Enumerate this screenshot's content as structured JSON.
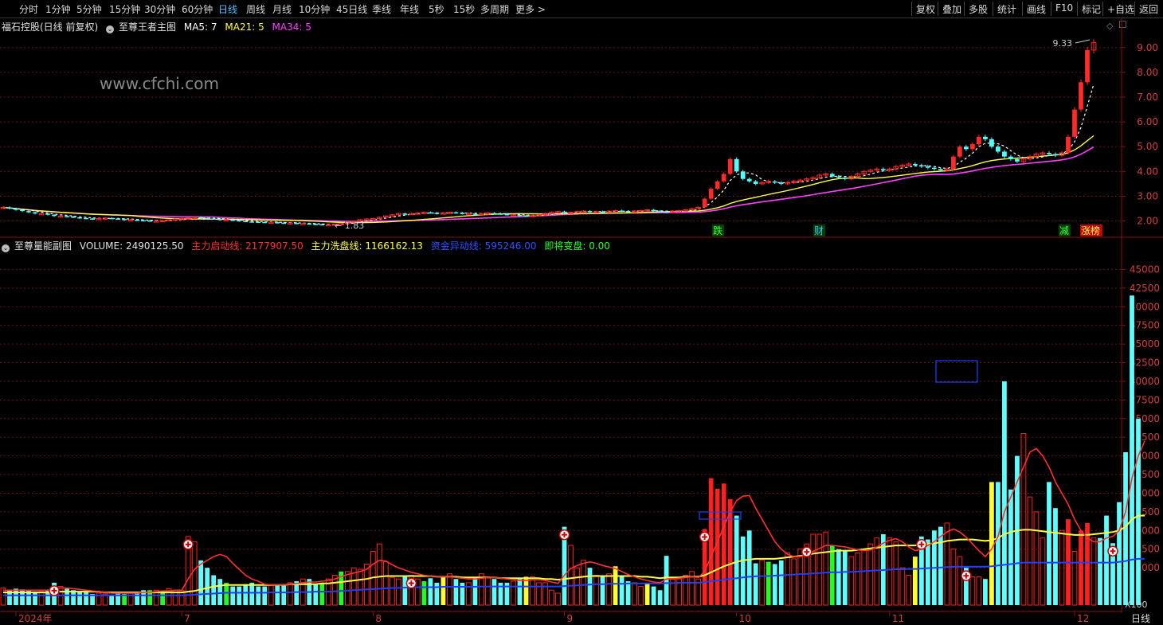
{
  "toolbar": {
    "periods": [
      "分时",
      "1分钟",
      "5分钟",
      "15分钟",
      "30分钟",
      "60分钟",
      "日线",
      "周线",
      "月线",
      "10分钟",
      "45日线",
      "季线",
      "年线",
      "5秒",
      "15秒",
      "多周期",
      "更多 >"
    ],
    "active_index": 6,
    "right": [
      "复权",
      "叠加",
      "多股",
      "统计",
      "画线",
      "F10",
      "标记",
      "+自选",
      "返回"
    ]
  },
  "main_panel": {
    "title": "福石控股(日线 前复权)",
    "indicator": "至尊王者主图",
    "ma5": "MA5: 7",
    "ma21": "MA21: 5",
    "ma34": "MA34: 5",
    "watermark": "www.cfchi.com",
    "high_label": "9.33",
    "low_label": "1.83",
    "markers": [
      "跌",
      "财",
      "减",
      "涨榜"
    ]
  },
  "sub_panel": {
    "title": "至尊量能副图",
    "volume": "VOLUME: 2490125.50",
    "line1": "主力启动线: 2177907.50",
    "line2": "主力洗盘线: 1166162.13",
    "line3": "资金异动线: 595246.00",
    "line4": "即将变盘: 0.00",
    "multiplier": "X100"
  },
  "bottom_label": "日线",
  "colors": {
    "up": "#ff2a2a",
    "down": "#54ffff",
    "ma5": "#ffffff",
    "ma21": "#ffff40",
    "ma34": "#ff40ff",
    "grid": "#6a1414",
    "vol_red": "#ff2020",
    "vol_cyan": "#60ffff",
    "vol_green": "#20ff20",
    "vol_yellow": "#ffff30",
    "line_red": "#ff3030",
    "line_yellow": "#ffff40",
    "line_blue": "#2040ff"
  },
  "chart_data": [
    {
      "type": "candlestick",
      "title": "福石控股(日线 前复权)",
      "ylim": [
        1.6,
        9.7
      ],
      "y_ticks": [
        2.0,
        3.0,
        4.0,
        5.0,
        6.0,
        7.0,
        8.0,
        9.0
      ],
      "x_ticks": [
        {
          "label": "2024年",
          "index": 2
        },
        {
          "label": "7",
          "index": 28
        },
        {
          "label": "8",
          "index": 58
        },
        {
          "label": "9",
          "index": 88
        },
        {
          "label": "10",
          "index": 115
        },
        {
          "label": "11",
          "index": 139
        },
        {
          "label": "12",
          "index": 168
        }
      ],
      "close": [
        2.55,
        2.5,
        2.45,
        2.4,
        2.35,
        2.3,
        2.3,
        2.25,
        2.2,
        2.2,
        2.18,
        2.15,
        2.12,
        2.1,
        2.08,
        2.1,
        2.12,
        2.1,
        2.08,
        2.05,
        2.05,
        2.03,
        2.02,
        2.0,
        2.0,
        2.02,
        2.05,
        2.08,
        2.1,
        2.12,
        2.15,
        2.12,
        2.1,
        2.08,
        2.05,
        2.05,
        2.03,
        2.0,
        1.98,
        1.97,
        1.96,
        1.95,
        1.95,
        1.93,
        1.92,
        1.92,
        1.9,
        1.9,
        1.88,
        1.87,
        1.85,
        1.85,
        1.87,
        1.9,
        1.95,
        2.0,
        2.05,
        2.08,
        2.1,
        2.15,
        2.2,
        2.25,
        2.3,
        2.28,
        2.3,
        2.32,
        2.35,
        2.33,
        2.3,
        2.32,
        2.35,
        2.33,
        2.3,
        2.3,
        2.28,
        2.3,
        2.32,
        2.3,
        2.28,
        2.25,
        2.25,
        2.22,
        2.2,
        2.22,
        2.25,
        2.3,
        2.35,
        2.38,
        2.35,
        2.35,
        2.38,
        2.4,
        2.38,
        2.38,
        2.35,
        2.4,
        2.42,
        2.4,
        2.38,
        2.4,
        2.42,
        2.45,
        2.4,
        2.38,
        2.35,
        2.4,
        2.42,
        2.45,
        2.5,
        2.55,
        2.9,
        3.3,
        3.6,
        3.9,
        4.5,
        4.0,
        3.7,
        3.6,
        3.5,
        3.55,
        3.6,
        3.55,
        3.5,
        3.55,
        3.6,
        3.65,
        3.7,
        3.75,
        3.85,
        3.9,
        3.8,
        3.75,
        3.7,
        3.8,
        3.9,
        4.0,
        4.05,
        4.1,
        4.05,
        4.1,
        4.2,
        4.25,
        4.3,
        4.25,
        4.2,
        4.15,
        4.1,
        4.05,
        4.1,
        4.6,
        5.0,
        4.9,
        5.1,
        5.4,
        5.3,
        5.0,
        4.8,
        4.6,
        4.5,
        4.4,
        4.5,
        4.6,
        4.7,
        4.75,
        4.7,
        4.65,
        4.75,
        5.4,
        6.5,
        7.6,
        8.9,
        9.2
      ],
      "volume": [
        2300,
        2000,
        2200,
        2100,
        1900,
        1800,
        1800,
        1900,
        3000,
        2500,
        2200,
        2000,
        1800,
        1700,
        1500,
        1600,
        1500,
        1400,
        1600,
        1500,
        1700,
        1600,
        2000,
        2000,
        2000,
        1900,
        2200,
        2000,
        2000,
        9200,
        8500,
        6000,
        5000,
        4000,
        3500,
        3000,
        2500,
        2500,
        2800,
        3000,
        2500,
        2500,
        2600,
        2700,
        2800,
        3000,
        3200,
        3500,
        3500,
        2800,
        3000,
        3500,
        4000,
        4500,
        4500,
        5000,
        4800,
        5500,
        7200,
        8200,
        5800,
        3700,
        3500,
        3800,
        4000,
        3500,
        3200,
        3600,
        3000,
        3800,
        4200,
        3500,
        3000,
        3000,
        3800,
        4200,
        3800,
        3500,
        3000,
        3000,
        3200,
        3500,
        3800,
        3800,
        3000,
        3000,
        2000,
        1600,
        10500,
        8000,
        5000,
        6000,
        5000,
        4000,
        3800,
        4200,
        5200,
        3800,
        3200,
        3000,
        2500,
        3000,
        2500,
        2000,
        6600,
        3500,
        3500,
        4000,
        4500,
        3500,
        10200,
        17000,
        15600,
        16300,
        14200,
        12000,
        9200,
        10000,
        5600,
        6000,
        5800,
        5500,
        6000,
        7000,
        6200,
        7500,
        8200,
        9500,
        9500,
        9800,
        8000,
        7500,
        7200,
        6500,
        7000,
        7500,
        8200,
        9000,
        9500,
        9000,
        8500,
        5000,
        4000,
        6500,
        9200,
        8800,
        10000,
        10500,
        11000,
        7500,
        6500,
        5000,
        3800,
        3800,
        3500,
        16500,
        16500,
        30000,
        15500,
        20000,
        23000,
        14500,
        12500,
        9000,
        16500,
        13000,
        10000,
        11500,
        7200,
        10000,
        11000,
        9000,
        9000,
        12000,
        8300,
        13800,
        20500,
        41500,
        25000
      ],
      "ma_vol_red": [
        2000,
        2000,
        2000,
        2000,
        2000,
        2000,
        2000,
        2000,
        2200,
        2300,
        2300,
        2200,
        2100,
        2000,
        1900,
        1800,
        1700,
        1600,
        1600,
        1600,
        1600,
        1600,
        1700,
        1700,
        1800,
        1900,
        1900,
        2000,
        2000,
        3500,
        4800,
        5500,
        6000,
        6500,
        6800,
        6500,
        5600,
        4800,
        4000,
        3500,
        3200,
        2800,
        2700,
        2700,
        2700,
        2800,
        2900,
        3000,
        3100,
        3100,
        3200,
        3300,
        3500,
        3800,
        4100,
        4300,
        4500,
        4800,
        5500,
        6000,
        5900,
        5400,
        5000,
        4700,
        4400,
        4200,
        4000,
        3900,
        3800,
        3800,
        3800,
        3700,
        3600,
        3500,
        3500,
        3600,
        3700,
        3700,
        3600,
        3500,
        3400,
        3300,
        3300,
        3400,
        3400,
        3300,
        3100,
        2900,
        4000,
        4900,
        5300,
        5600,
        5800,
        5600,
        5300,
        5100,
        4900,
        4500,
        4100,
        3800,
        3500,
        3300,
        3100,
        3000,
        3500,
        3500,
        3600,
        3700,
        3800,
        3700,
        4500,
        6500,
        8500,
        10500,
        12500,
        14000,
        14600,
        14700,
        13000,
        11500,
        10000,
        8500,
        7500,
        6800,
        6500,
        6500,
        6700,
        7200,
        7600,
        8000,
        8000,
        7900,
        7800,
        7600,
        7400,
        7300,
        7400,
        7800,
        8300,
        8700,
        8900,
        8500,
        7800,
        7300,
        7500,
        8000,
        8500,
        9200,
        9800,
        10200,
        9800,
        9100,
        8200,
        7300,
        6500,
        7500,
        9200,
        12500,
        14500,
        16500,
        18500,
        20500,
        21000,
        20000,
        18500,
        16500,
        15000,
        13500,
        11500,
        10000,
        9000,
        8500,
        8500,
        9000,
        9200,
        10000,
        12500,
        17000,
        20000,
        22000
      ],
      "ma_vol_yellow": [
        1700,
        1700,
        1700,
        1700,
        1700,
        1700,
        1700,
        1700,
        1800,
        1800,
        1800,
        1800,
        1800,
        1800,
        1800,
        1800,
        1700,
        1700,
        1700,
        1700,
        1700,
        1700,
        1700,
        1700,
        1700,
        1700,
        1700,
        1700,
        1700,
        1800,
        1900,
        2100,
        2300,
        2500,
        2600,
        2700,
        2700,
        2700,
        2700,
        2700,
        2700,
        2700,
        2700,
        2700,
        2700,
        2800,
        2800,
        2800,
        2800,
        2800,
        2900,
        2900,
        3000,
        3100,
        3200,
        3300,
        3400,
        3500,
        3700,
        3800,
        3900,
        3900,
        3900,
        3900,
        3900,
        3900,
        3900,
        3900,
        3800,
        3800,
        3800,
        3800,
        3700,
        3700,
        3700,
        3700,
        3700,
        3700,
        3600,
        3600,
        3600,
        3600,
        3600,
        3600,
        3600,
        3500,
        3500,
        3400,
        3500,
        3600,
        3700,
        3800,
        3900,
        3900,
        3900,
        3900,
        3900,
        3900,
        3900,
        3900,
        3800,
        3800,
        3700,
        3600,
        3700,
        3700,
        3700,
        3800,
        3800,
        3800,
        4000,
        4400,
        4800,
        5200,
        5500,
        5800,
        6000,
        6100,
        6200,
        6200,
        6200,
        6200,
        6300,
        6400,
        6500,
        6600,
        6700,
        6900,
        7000,
        7100,
        7200,
        7300,
        7300,
        7300,
        7400,
        7500,
        7600,
        7700,
        7800,
        7900,
        8000,
        8000,
        8000,
        8000,
        8100,
        8200,
        8300,
        8400,
        8600,
        8700,
        8800,
        8800,
        8800,
        8700,
        8600,
        8700,
        9000,
        9500,
        9800,
        10000,
        10100,
        10100,
        10000,
        9900,
        9800,
        9700,
        9600,
        9500,
        9400,
        9400,
        9400,
        9500,
        9600,
        9700,
        9800,
        10000,
        10500,
        11500,
        12000,
        12000
      ],
      "ma_vol_blue": [
        1300,
        1300,
        1300,
        1300,
        1300,
        1300,
        1300,
        1300,
        1300,
        1300,
        1300,
        1300,
        1300,
        1300,
        1300,
        1300,
        1300,
        1300,
        1300,
        1300,
        1300,
        1300,
        1300,
        1300,
        1300,
        1300,
        1300,
        1300,
        1300,
        1350,
        1400,
        1450,
        1500,
        1550,
        1600,
        1650,
        1650,
        1650,
        1650,
        1650,
        1650,
        1650,
        1700,
        1700,
        1700,
        1700,
        1750,
        1750,
        1750,
        1800,
        1800,
        1800,
        1850,
        1900,
        1950,
        2000,
        2050,
        2100,
        2150,
        2200,
        2250,
        2300,
        2300,
        2350,
        2350,
        2400,
        2400,
        2400,
        2400,
        2450,
        2450,
        2450,
        2450,
        2450,
        2450,
        2500,
        2500,
        2500,
        2500,
        2500,
        2500,
        2500,
        2500,
        2500,
        2500,
        2500,
        2500,
        2500,
        2550,
        2600,
        2650,
        2700,
        2750,
        2800,
        2800,
        2850,
        2850,
        2850,
        2900,
        2900,
        2900,
        2900,
        2900,
        2900,
        2950,
        2950,
        3000,
        3000,
        3000,
        3000,
        3100,
        3200,
        3300,
        3400,
        3500,
        3600,
        3700,
        3800,
        3850,
        3900,
        3900,
        3950,
        4000,
        4050,
        4100,
        4150,
        4200,
        4250,
        4300,
        4350,
        4400,
        4400,
        4450,
        4450,
        4500,
        4550,
        4600,
        4650,
        4700,
        4750,
        4800,
        4800,
        4850,
        4850,
        4900,
        4950,
        5000,
        5050,
        5100,
        5150,
        5150,
        5150,
        5150,
        5150,
        5150,
        5200,
        5300,
        5400,
        5500,
        5600,
        5700,
        5700,
        5700,
        5700,
        5700,
        5700,
        5700,
        5700,
        5700,
        5700,
        5700,
        5700,
        5700,
        5700,
        5700,
        5800,
        5900,
        6100,
        6200,
        6200
      ],
      "vol_ylim": [
        0,
        47500
      ],
      "vol_ticks": [
        5000,
        7500,
        10000,
        12500,
        15000,
        17500,
        20000,
        22500,
        25000,
        27500,
        30000,
        32500,
        35000,
        37500,
        40000,
        42500,
        45000
      ]
    }
  ]
}
